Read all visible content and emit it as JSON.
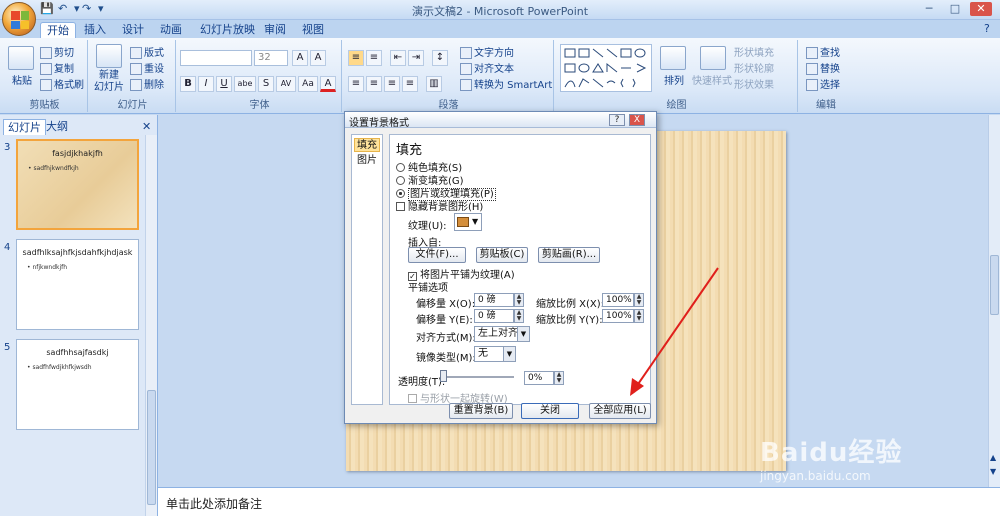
{
  "window": {
    "title": "演示文稿2 - Microsoft PowerPoint",
    "minimize": "─",
    "maximize": "□",
    "close": "✕"
  },
  "qat": {
    "save": "💾",
    "undo": "↶",
    "redo": "↷",
    "dropdown": "▾"
  },
  "tabs": [
    "开始",
    "插入",
    "设计",
    "动画",
    "幻灯片放映",
    "审阅",
    "视图"
  ],
  "active_tab": "开始",
  "ribbon": {
    "clipboard": {
      "label": "剪贴板",
      "paste": "粘贴",
      "cut": "剪切",
      "copy": "复制",
      "format_painter": "格式刷"
    },
    "slides": {
      "label": "幻灯片",
      "new_slide": "新建\n幻灯片",
      "layout": "版式",
      "reset": "重设",
      "delete": "删除"
    },
    "font": {
      "label": "字体",
      "size": "32",
      "buttons": [
        "B",
        "I",
        "U",
        "abe",
        "S",
        "AV",
        "Aa",
        "A"
      ]
    },
    "paragraph": {
      "label": "段落",
      "text_direction": "文字方向",
      "align_text": "对齐文本",
      "convert_smartart": "转换为 SmartArt"
    },
    "drawing": {
      "label": "绘图",
      "arrange": "排列",
      "quick_styles": "快速样式",
      "shape_fill": "形状填充",
      "shape_outline": "形状轮廓",
      "shape_effects": "形状效果"
    },
    "editing": {
      "label": "编辑",
      "find": "查找",
      "replace": "替换",
      "select": "选择"
    }
  },
  "left_pane": {
    "tabs": [
      "幻灯片",
      "大纲"
    ],
    "close": "✕",
    "slides": [
      {
        "num": "3",
        "title": "fasjdjkhakjfh",
        "bullet": "• sadfhjkwndfkjh",
        "selected": true
      },
      {
        "num": "4",
        "title": "sadfhlksajhfkjsdahfkjhdjask",
        "bullet": "• nfjkwndkjfh",
        "selected": false
      },
      {
        "num": "5",
        "title": "sadfhhsajfasdkj",
        "bullet": "• sadfhfwdjkhfkjwsdh",
        "selected": false
      }
    ]
  },
  "notes": {
    "placeholder": "单击此处添加备注"
  },
  "dialog": {
    "title": "设置背景格式",
    "help": "?",
    "close": "X",
    "side": [
      "填充",
      "图片"
    ],
    "heading": "填充",
    "radios": [
      {
        "label": "纯色填充(S)",
        "checked": false
      },
      {
        "label": "渐变填充(G)",
        "checked": false
      },
      {
        "label": "图片或纹理填充(P)",
        "checked": true
      }
    ],
    "hide_bg": "隐藏背景图形(H)",
    "texture_label": "纹理(U):",
    "insert_from": "插入自:",
    "btn_file": "文件(F)...",
    "btn_clipboard": "剪贴板(C)",
    "btn_clipart": "剪贴画(R)...",
    "tile_label": "将图片平铺为纹理(A)",
    "tiling_options": "平铺选项",
    "offset_x_label": "偏移量 X(O):",
    "offset_x": "0 磅",
    "offset_y_label": "偏移量 Y(E):",
    "offset_y": "0 磅",
    "scale_x_label": "缩放比例 X(X):",
    "scale_x": "100%",
    "scale_y_label": "缩放比例 Y(Y):",
    "scale_y": "100%",
    "align_label": "对齐方式(M):",
    "align_value": "左上对齐",
    "mirror_label": "镜像类型(M):",
    "mirror_value": "无",
    "transparency_label": "透明度(T):",
    "transparency_value": "0%",
    "rotate_label": "与形状一起旋转(W)",
    "btn_reset": "重置背景(B)",
    "btn_close": "关闭",
    "btn_apply_all": "全部应用(L)"
  },
  "watermark": {
    "brand": "Baidu经验",
    "url": "jingyan.baidu.com"
  },
  "colors": {
    "annotation_arrow": "#e0201c",
    "slide_texture": "#eed5a8",
    "selected_border": "#f3a43c"
  }
}
